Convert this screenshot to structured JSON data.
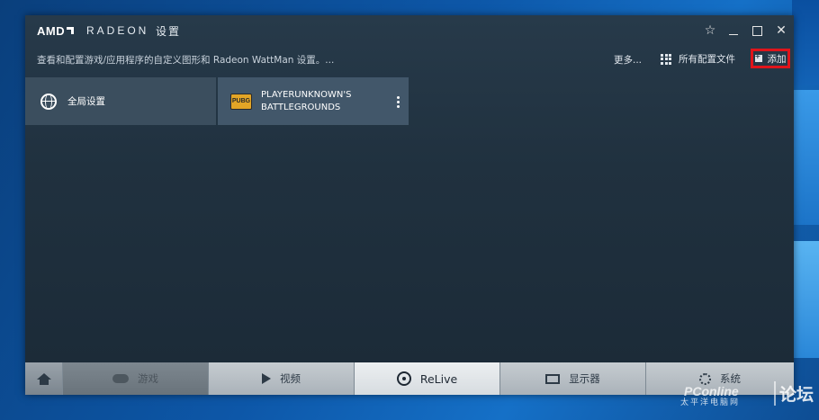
{
  "window": {
    "brand": "AMD",
    "app_name": "RADEON",
    "section": "设置"
  },
  "toolbar": {
    "description": "查看和配置游戏/应用程序的自定义图形和 Radeon WattMan 设置。...",
    "more_label": "更多...",
    "profiles_label": "所有配置文件",
    "add_label": "添加"
  },
  "tiles": [
    {
      "label": "全局设置",
      "icon": "globe-icon"
    },
    {
      "label": "PLAYERUNKNOWN'S BATTLEGROUNDS",
      "icon": "pubg-logo",
      "logo_text": "PUBG"
    }
  ],
  "nav": [
    {
      "label": "",
      "icon": "home-icon"
    },
    {
      "label": "游戏",
      "icon": "gamepad-icon"
    },
    {
      "label": "视频",
      "icon": "play-icon"
    },
    {
      "label": "ReLive",
      "icon": "relive-icon",
      "active": true
    },
    {
      "label": "显示器",
      "icon": "monitor-icon"
    },
    {
      "label": "系统",
      "icon": "gear-icon"
    }
  ],
  "watermark": {
    "brand": "PConline",
    "sub": "太平洋电脑网",
    "forum": "论坛"
  },
  "colors": {
    "highlight_box": "#e0141b",
    "window_bg": "#223444",
    "active_tab_bg": "#eceff1"
  }
}
